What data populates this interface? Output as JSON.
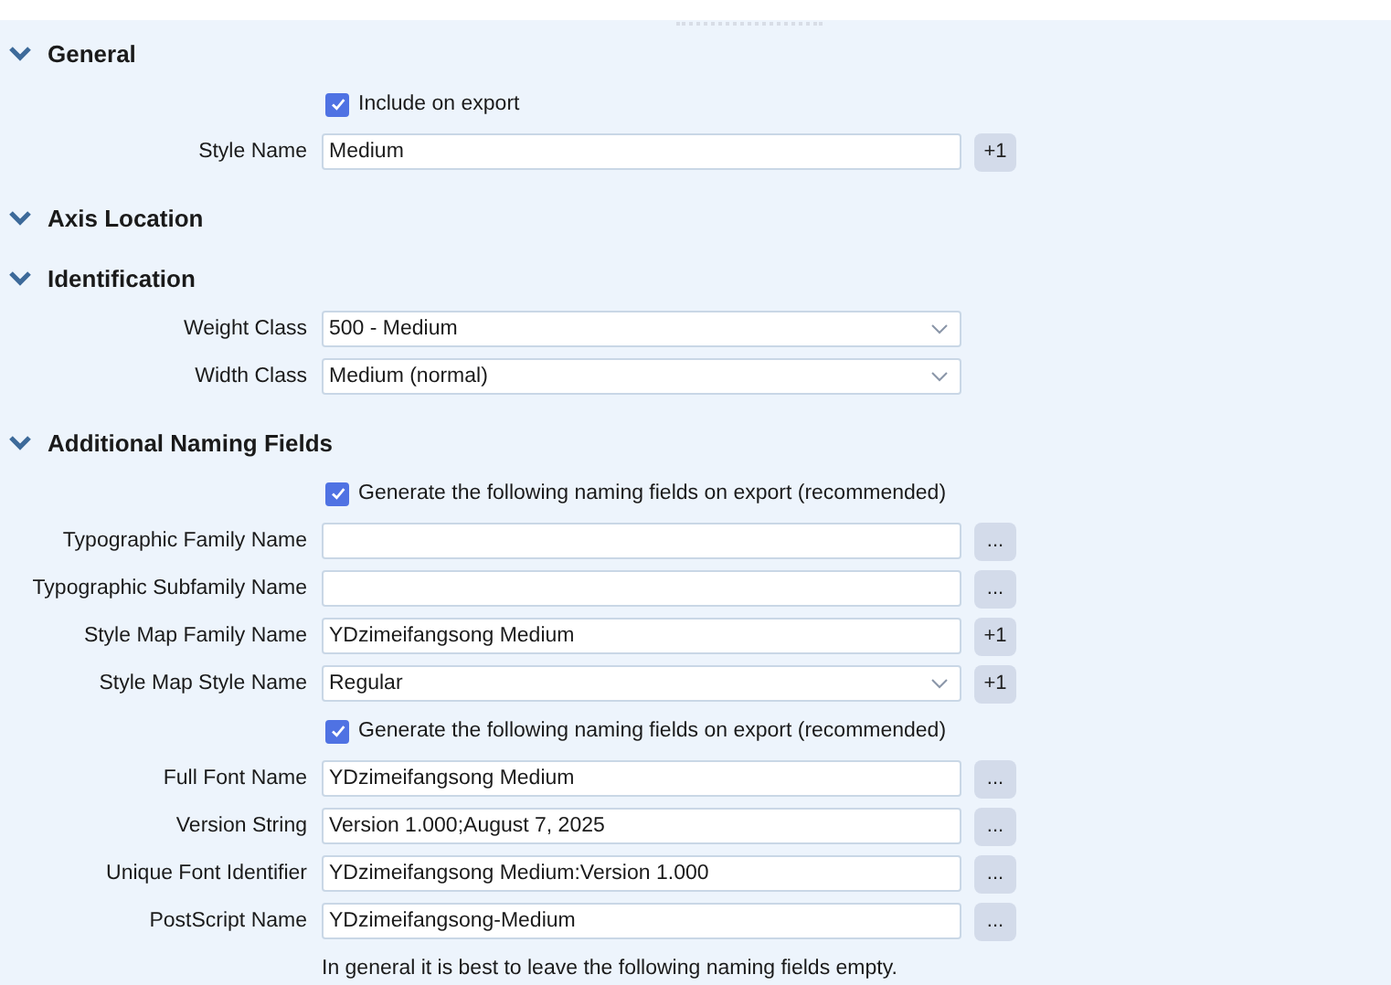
{
  "sections": [
    {
      "title": "General",
      "expanded": true,
      "rows": [
        {
          "kind": "checkbox",
          "label": "Include on export",
          "checked": true
        },
        {
          "kind": "text",
          "label": "Style Name",
          "value": "Medium",
          "button": "+1"
        }
      ]
    },
    {
      "title": "Axis Location",
      "expanded": true
    },
    {
      "title": "Identification",
      "expanded": true,
      "rows": [
        {
          "kind": "select",
          "label": "Weight Class",
          "value": "500 - Medium"
        },
        {
          "kind": "select",
          "label": "Width Class",
          "value": "Medium (normal)"
        }
      ]
    },
    {
      "title": "Additional Naming Fields",
      "expanded": true,
      "rows": [
        {
          "kind": "checkbox",
          "label": "Generate the following naming fields on export (recommended)",
          "checked": true
        },
        {
          "kind": "text",
          "label": "Typographic Family Name",
          "value": "",
          "button": "..."
        },
        {
          "kind": "text",
          "label": "Typographic Subfamily Name",
          "value": "",
          "button": "..."
        },
        {
          "kind": "text",
          "label": "Style Map Family Name",
          "value": "YDzimeifangsong Medium",
          "button": "+1"
        },
        {
          "kind": "select",
          "label": "Style Map Style Name",
          "value": "Regular",
          "button": "+1"
        },
        {
          "kind": "checkbox",
          "label": "Generate the following naming fields on export (recommended)",
          "checked": true
        },
        {
          "kind": "text",
          "label": "Full Font Name",
          "value": "YDzimeifangsong Medium",
          "button": "..."
        },
        {
          "kind": "text",
          "label": "Version String",
          "value": "Version 1.000;August 7, 2025",
          "button": "..."
        },
        {
          "kind": "text",
          "label": "Unique Font Identifier",
          "value": "YDzimeifangsong Medium:Version 1.000",
          "button": "..."
        },
        {
          "kind": "text",
          "label": "PostScript Name",
          "value": "YDzimeifangsong-Medium",
          "button": "..."
        },
        {
          "kind": "note",
          "label": "In general it is best to leave the following naming fields empty."
        }
      ]
    }
  ]
}
